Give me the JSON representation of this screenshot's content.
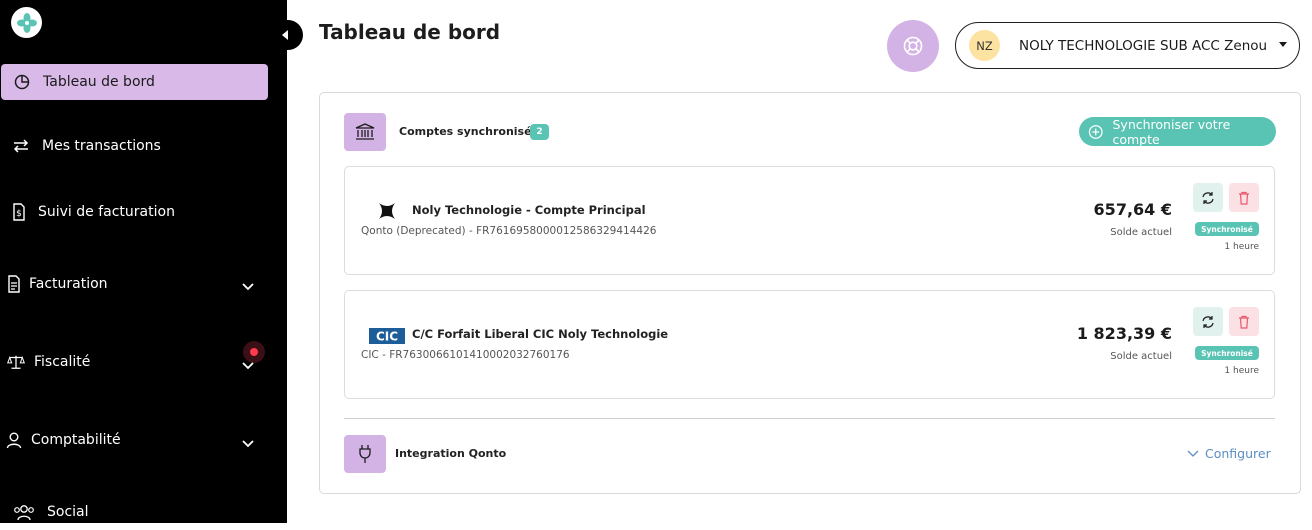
{
  "sidebar": {
    "items": [
      {
        "label": "Tableau de bord",
        "icon": "pie-chart-icon"
      },
      {
        "label": "Mes transactions",
        "icon": "arrows-exchange-icon"
      },
      {
        "label": "Suivi de facturation",
        "icon": "invoice-dollar-icon"
      },
      {
        "label": "Facturation",
        "icon": "document-icon"
      },
      {
        "label": "Fiscalité",
        "icon": "scale-icon"
      },
      {
        "label": "Comptabilité",
        "icon": "user-icon"
      },
      {
        "label": "Social",
        "icon": "users-icon"
      }
    ]
  },
  "header": {
    "title": "Tableau de bord",
    "avatar_initials": "NZ",
    "account_name": "NOLY TECHNOLOGIE SUB ACC Zenou"
  },
  "synced": {
    "label": "Comptes synchronisés",
    "count": "2",
    "sync_button": "Synchroniser votre compte",
    "accounts": [
      {
        "name": "Noly Technologie - Compte Principal",
        "iban": "Qonto (Deprecated) - FR7616958000012586329414426",
        "amount": "657,64 €",
        "amount_label": "Solde actuel",
        "status": "Synchronisé",
        "time": "1 heure"
      },
      {
        "name": "C/C Forfait Liberal CIC Noly Technologie",
        "iban": "CIC - FR7630066101410002032760176",
        "amount": "1 823,39 €",
        "amount_label": "Solde actuel",
        "status": "Synchronisé",
        "time": "1 heure",
        "logo_text": "CIC"
      }
    ]
  },
  "integration": {
    "label": "Integration Qonto",
    "configure": "Configurer"
  },
  "colors": {
    "accent_purple": "#d3b3e6",
    "teal": "#5ac4b4",
    "danger_bg": "#fbe0e4",
    "link_blue": "#5b8ec4"
  }
}
